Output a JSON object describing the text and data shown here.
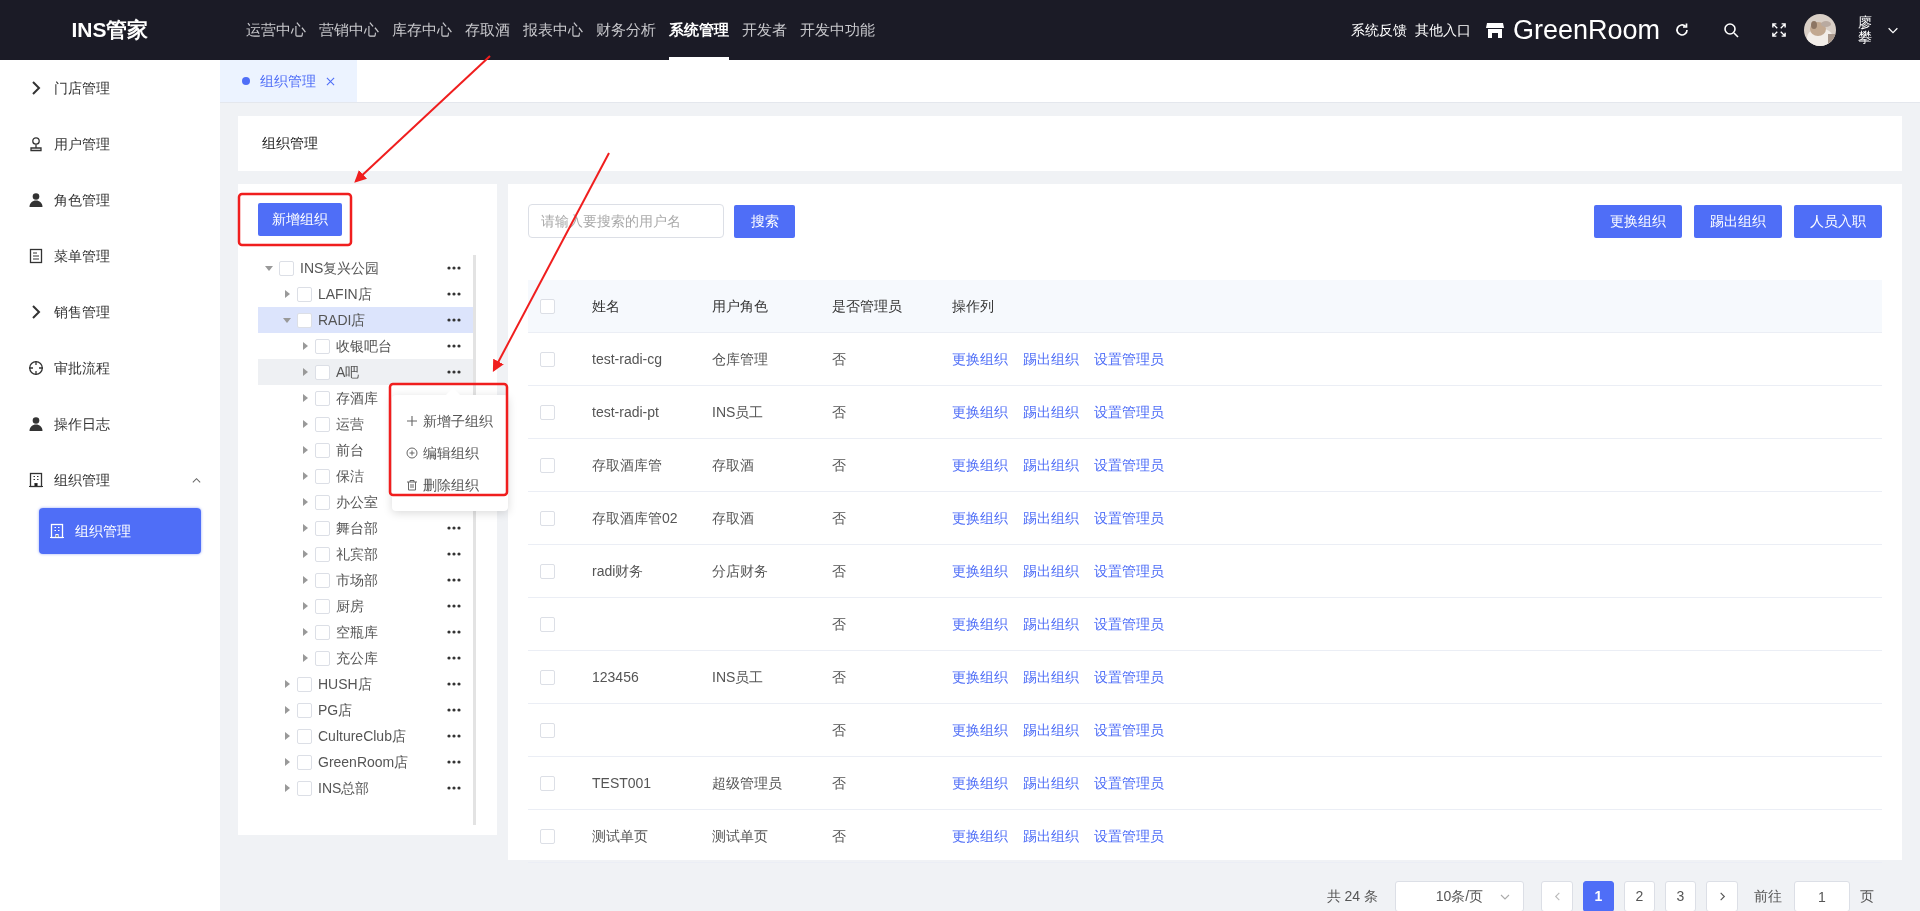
{
  "app": {
    "logo": "INS管家"
  },
  "top_nav": [
    {
      "label": "运营中心",
      "selected": false
    },
    {
      "label": "营销中心",
      "selected": false
    },
    {
      "label": "库存中心",
      "selected": false
    },
    {
      "label": "存取酒",
      "selected": false
    },
    {
      "label": "报表中心",
      "selected": false
    },
    {
      "label": "财务分析",
      "selected": false
    },
    {
      "label": "系统管理",
      "selected": true
    },
    {
      "label": "开发者",
      "selected": false
    },
    {
      "label": "开发中功能",
      "selected": false
    }
  ],
  "top_right": {
    "links": [
      "系统反馈",
      "其他入口"
    ],
    "store": "GreenRoom",
    "user": "廖攀"
  },
  "sidebar": [
    {
      "label": "门店管理",
      "selected": false
    },
    {
      "label": "用户管理",
      "selected": false
    },
    {
      "label": "角色管理",
      "selected": false
    },
    {
      "label": "菜单管理",
      "selected": false
    },
    {
      "label": "销售管理",
      "selected": false
    },
    {
      "label": "审批流程",
      "selected": false
    },
    {
      "label": "操作日志",
      "selected": false
    },
    {
      "label": "组织管理",
      "selected": false,
      "expanded": true,
      "children": [
        {
          "label": "组织管理",
          "selected": true
        }
      ]
    }
  ],
  "tabs": [
    {
      "label": "组织管理",
      "selected": true
    }
  ],
  "page_title": "组织管理",
  "tree_panel": {
    "add_button": "新增组织",
    "tree": [
      {
        "label": "INS复兴公园",
        "expanded": true,
        "checked": false,
        "selected": false,
        "hovered": false,
        "children": [
          {
            "label": "LAFIN店",
            "expanded": false,
            "checked": false,
            "selected": false,
            "hovered": false
          },
          {
            "label": "RADI店",
            "expanded": true,
            "checked": false,
            "selected": true,
            "hovered": false,
            "children": [
              {
                "label": "收银吧台",
                "expanded": false,
                "checked": false,
                "selected": false,
                "hovered": false
              },
              {
                "label": "A吧",
                "expanded": false,
                "checked": false,
                "selected": false,
                "hovered": true
              },
              {
                "label": "存酒库",
                "expanded": false,
                "checked": false,
                "selected": false,
                "hovered": false
              },
              {
                "label": "运营",
                "expanded": false,
                "checked": false,
                "selected": false,
                "hovered": false
              },
              {
                "label": "前台",
                "expanded": false,
                "checked": false,
                "selected": false,
                "hovered": false
              },
              {
                "label": "保洁",
                "expanded": false,
                "checked": false,
                "selected": false,
                "hovered": false
              },
              {
                "label": "办公室",
                "expanded": false,
                "checked": false,
                "selected": false,
                "hovered": false
              },
              {
                "label": "舞台部",
                "expanded": false,
                "checked": false,
                "selected": false,
                "hovered": false
              },
              {
                "label": "礼宾部",
                "expanded": false,
                "checked": false,
                "selected": false,
                "hovered": false
              },
              {
                "label": "市场部",
                "expanded": false,
                "checked": false,
                "selected": false,
                "hovered": false
              },
              {
                "label": "厨房",
                "expanded": false,
                "checked": false,
                "selected": false,
                "hovered": false
              },
              {
                "label": "空瓶库",
                "expanded": false,
                "checked": false,
                "selected": false,
                "hovered": false
              },
              {
                "label": "充公库",
                "expanded": false,
                "checked": false,
                "selected": false,
                "hovered": false
              }
            ]
          },
          {
            "label": "HUSH店",
            "expanded": false,
            "checked": false,
            "selected": false,
            "hovered": false
          },
          {
            "label": "PG店",
            "expanded": false,
            "checked": false,
            "selected": false,
            "hovered": false
          },
          {
            "label": "CultureClub店",
            "expanded": false,
            "checked": false,
            "selected": false,
            "hovered": false
          },
          {
            "label": "GreenRoom店",
            "expanded": false,
            "checked": false,
            "selected": false,
            "hovered": false
          },
          {
            "label": "INS总部",
            "expanded": false,
            "checked": false,
            "selected": false,
            "hovered": false
          }
        ]
      }
    ],
    "context_menu": [
      {
        "label": "新增子组织",
        "kind": "add"
      },
      {
        "label": "编辑组织",
        "kind": "edit"
      },
      {
        "label": "删除组织",
        "kind": "delete"
      }
    ]
  },
  "user_panel": {
    "search": {
      "placeholder": "请输入要搜索的用户名",
      "button": "搜索"
    },
    "buttons": [
      "更换组织",
      "踢出组织",
      "人员入职"
    ],
    "table": {
      "columns": [
        "姓名",
        "用户角色",
        "是否管理员",
        "操作列"
      ],
      "header_checked": false,
      "rows": [
        {
          "checked": false,
          "name": "test-radi-cg",
          "role": "仓库管理",
          "admin": "否",
          "actions": [
            "更换组织",
            "踢出组织",
            "设置管理员"
          ]
        },
        {
          "checked": false,
          "name": "test-radi-pt",
          "role": "INS员工",
          "admin": "否",
          "actions": [
            "更换组织",
            "踢出组织",
            "设置管理员"
          ]
        },
        {
          "checked": false,
          "name": "存取酒库管",
          "role": "存取酒",
          "admin": "否",
          "actions": [
            "更换组织",
            "踢出组织",
            "设置管理员"
          ]
        },
        {
          "checked": false,
          "name": "存取酒库管02",
          "role": "存取酒",
          "admin": "否",
          "actions": [
            "更换组织",
            "踢出组织",
            "设置管理员"
          ]
        },
        {
          "checked": false,
          "name": "radi财务",
          "role": "分店财务",
          "admin": "否",
          "actions": [
            "更换组织",
            "踢出组织",
            "设置管理员"
          ]
        },
        {
          "checked": false,
          "admin": "否",
          "actions": [
            "更换组织",
            "踢出组织",
            "设置管理员"
          ]
        },
        {
          "checked": false,
          "name": "123456",
          "role": "INS员工",
          "admin": "否",
          "actions": [
            "更换组织",
            "踢出组织",
            "设置管理员"
          ]
        },
        {
          "checked": false,
          "admin": "否",
          "actions": [
            "更换组织",
            "踢出组织",
            "设置管理员"
          ]
        },
        {
          "checked": false,
          "name": "TEST001",
          "role": "超级管理员",
          "admin": "否",
          "actions": [
            "更换组织",
            "踢出组织",
            "设置管理员"
          ]
        },
        {
          "checked": false,
          "name": "测试单页",
          "role": "测试单页",
          "admin": "否",
          "actions": [
            "更换组织",
            "踢出组织",
            "设置管理员"
          ]
        }
      ]
    }
  },
  "pagination": {
    "total": "共 24 条",
    "page_size": "10条/页",
    "pages": [
      {
        "label": "1",
        "selected": true
      },
      {
        "label": "2",
        "selected": false
      },
      {
        "label": "3",
        "selected": false
      }
    ],
    "goto_label": "前往",
    "goto_value": "1",
    "goto_suffix": "页"
  }
}
